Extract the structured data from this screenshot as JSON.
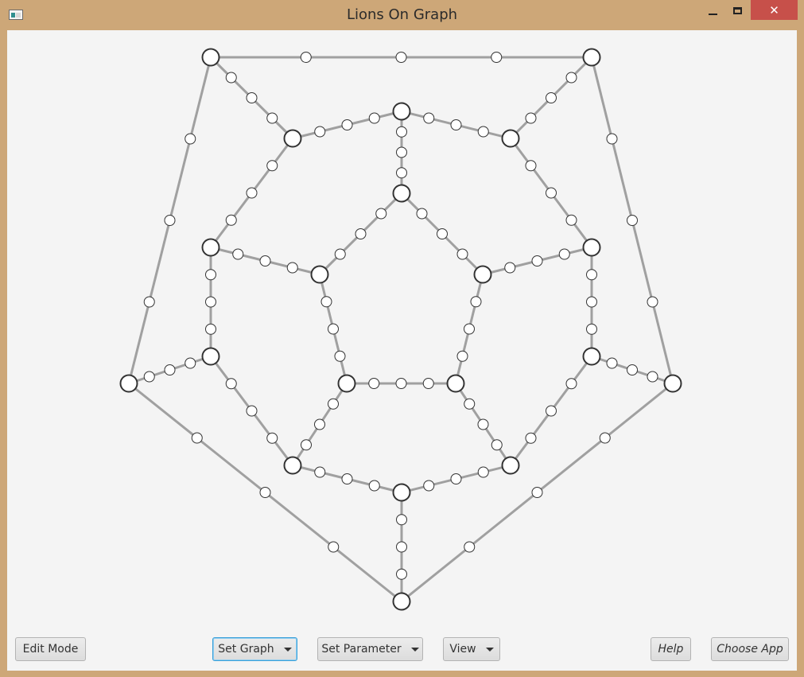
{
  "window": {
    "title": "Lions On Graph",
    "close_glyph": "✕"
  },
  "colors": {
    "lion": "#0a12e0",
    "man": "#d80f0f",
    "edge": "#a0a0a0",
    "node_fill": "#ffffff",
    "node_stroke": "#333333"
  },
  "toolbar": {
    "edit_mode": "Edit Mode",
    "set_graph": "Set Graph",
    "set_parameter": "Set Parameter",
    "view": "View",
    "help": "Help",
    "choose_app": "Choose App"
  }
}
